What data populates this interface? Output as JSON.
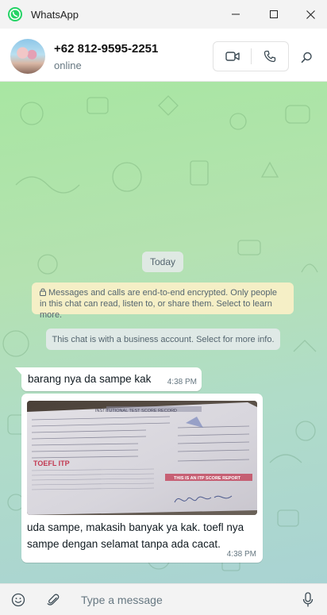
{
  "window": {
    "title": "WhatsApp",
    "controls": [
      "minimize",
      "maximize",
      "close"
    ]
  },
  "header": {
    "contact_name": "+62 812-9595-2251",
    "status": "online",
    "icons": [
      "video-call-icon",
      "voice-call-icon",
      "search-icon"
    ]
  },
  "chat": {
    "date_chip": "Today",
    "encryption_notice": "Messages and calls are end-to-end encrypted. Only people in this chat can read, listen to, or share them. Select to learn more.",
    "business_notice": "This chat is with a business account. Select for more info.",
    "messages": [
      {
        "text": "barang nya da sampe kak",
        "time": "4:38 PM",
        "direction": "incoming"
      },
      {
        "has_image": true,
        "image_text": {
          "header": "INSTITUTIONAL TEST SCORE RECORD",
          "brand": "TOEFL ITP",
          "stamp": "THIS IS AN ITP SCORE REPORT",
          "signature": "Bahagia Warm 2n"
        },
        "text": "uda sampe, makasih banyak ya kak. toefl nya sampe dengan selamat tanpa ada cacat.",
        "time": "4:38 PM",
        "direction": "incoming"
      }
    ]
  },
  "composer": {
    "placeholder": "Type a message",
    "icons": [
      "emoji-icon",
      "attach-icon",
      "microphone-icon"
    ]
  },
  "colors": {
    "chat_background": "#b0dcc8",
    "bubble": "#ffffff",
    "encryption_notice_bg": "#f5efc6",
    "brand_green": "#25d366"
  }
}
